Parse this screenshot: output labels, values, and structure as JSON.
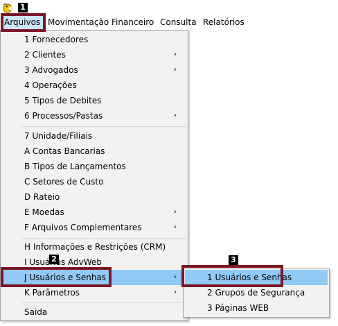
{
  "badges": {
    "step1": "1",
    "step2": "2",
    "step3": "3"
  },
  "menubar": [
    "Arquivos",
    "Movimentação",
    "Financeiro",
    "Consulta",
    "Relatórios"
  ],
  "arquivos_menu": [
    "1 Fornecedores",
    "2 Clientes",
    "3 Advogados",
    "4 Operações",
    "5 Tipos de Debites",
    "6 Processos/Pastas",
    "7 Unidade/Filiais",
    "A Contas Bancarias",
    "B Tipos de Lançamentos",
    "C Setores de Custo",
    "D Rateio",
    "E Moedas",
    "F Arquivos Complementares",
    "H Informações e Restrições (CRM)",
    "I Usuários AdvWeb",
    "J Usuários e Senhas",
    "K Parâmetros",
    "Saida"
  ],
  "submenu_arrow": "›",
  "usuarios_submenu": [
    "1 Usuários e Senhas",
    "2 Grupos de Segurança",
    "3 Páginas WEB"
  ],
  "colors": {
    "menu_bg": "#f2f2f2",
    "highlight": "#91c9f7",
    "active_menubar": "#cce4f7",
    "annotation_box": "#7b1728"
  },
  "icons": {
    "app": "pacman-like-yellow-app-icon",
    "arrow": "chevron-right-icon"
  }
}
